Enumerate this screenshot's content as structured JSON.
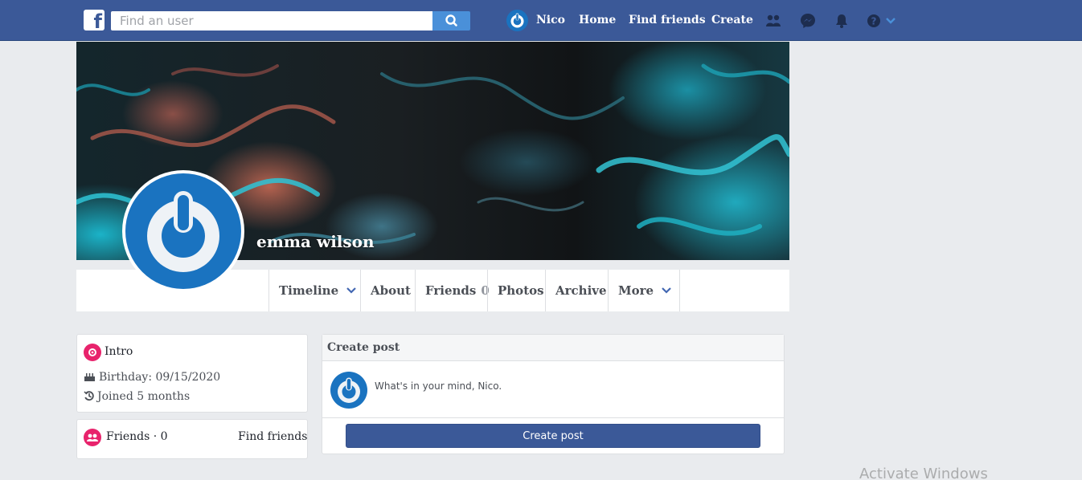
{
  "topbar": {
    "search_placeholder": "Find an user",
    "user_name": "Nico",
    "links": [
      "Home",
      "Find friends",
      "Create"
    ]
  },
  "profile": {
    "name": "emma wilson"
  },
  "tabs": {
    "timeline": "Timeline",
    "about": "About",
    "friends": "Friends",
    "friends_count": "0",
    "photos": "Photos",
    "archive": "Archive",
    "more": "More"
  },
  "intro": {
    "title": "Intro",
    "birthday": "Birthday: 09/15/2020",
    "joined": "Joined 5 months"
  },
  "friends_card": {
    "title": "Friends · 0",
    "find_link": "Find friends"
  },
  "create_post": {
    "header": "Create post",
    "placeholder": "What's in your mind, Nico.",
    "button": "Create post"
  },
  "watermark": "Activate Windows",
  "colors": {
    "brand": "#3b5998",
    "accent_pink": "#e8236c",
    "avatar_blue": "#1a73c0"
  },
  "icons": [
    "facebook-logo-icon",
    "search-icon",
    "friend-requests-icon",
    "messenger-icon",
    "bell-icon",
    "help-icon",
    "chevron-down-icon",
    "cake-icon",
    "history-icon"
  ]
}
